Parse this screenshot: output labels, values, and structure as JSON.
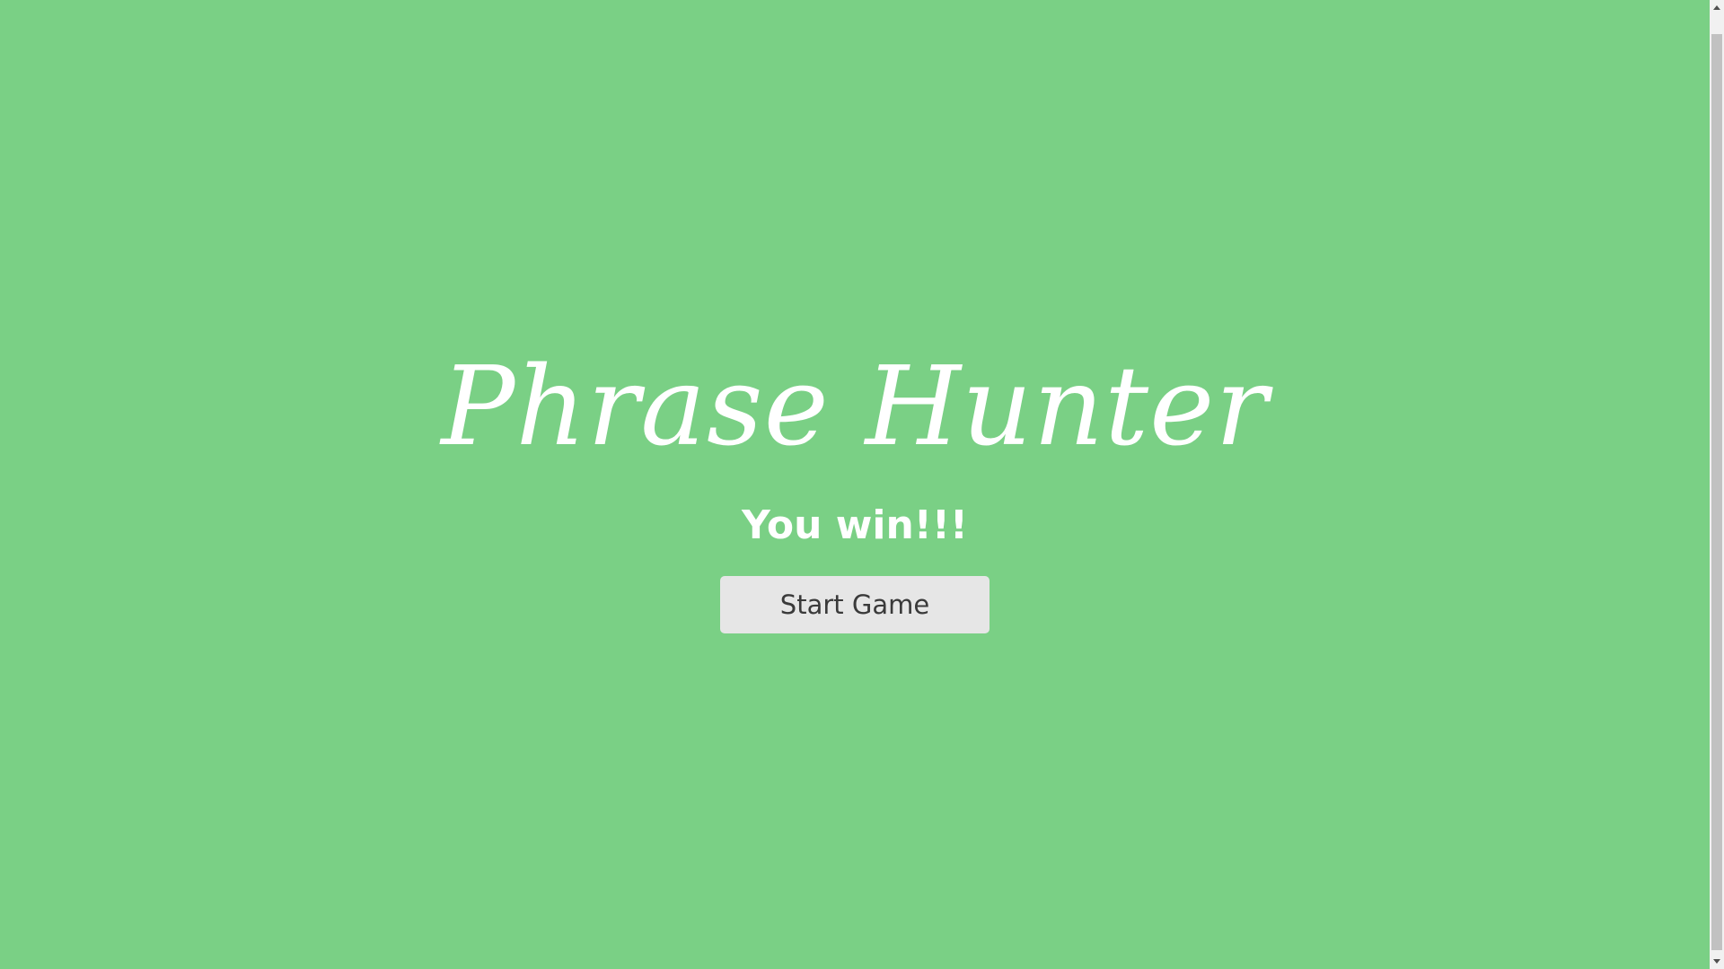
{
  "overlay": {
    "title": "Phrase Hunter",
    "message": "You win!!!",
    "start_button_label": "Start Game"
  },
  "colors": {
    "background": "#7ad085",
    "title_text": "#ffffff",
    "button_background": "#e6e6e6",
    "button_text": "#3a3a3a"
  }
}
